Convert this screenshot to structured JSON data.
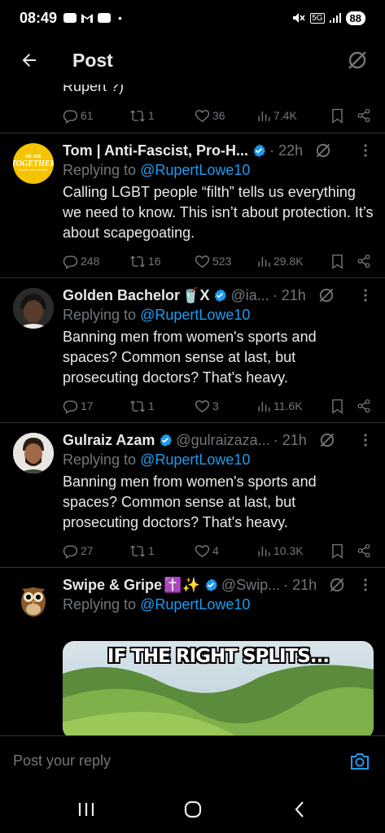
{
  "status": {
    "time": "08:49",
    "network": "5G",
    "battery": "88",
    "dot": "•"
  },
  "header": {
    "title": "Post"
  },
  "previous": {
    "text_tail": "Rupert ?)",
    "replies": "61",
    "reposts": "1",
    "likes": "36",
    "views": "7.4K"
  },
  "tweets": [
    {
      "name": "Tom | Anti-Fascist, Pro-H...",
      "handle": "",
      "time": "· 22h",
      "replying_prefix": "Replying to ",
      "replying_to": "@RupertLowe10",
      "text": "Calling LGBT people “filth” tells us everything we need to know. This isn’t about protection. It’s about scapegoating.",
      "replies": "248",
      "reposts": "16",
      "likes": "523",
      "views": "29.8K",
      "avatar_text_top": "WE ARE",
      "avatar_text_main": "TOGETHER",
      "avatar_text_bottom": "AGAINST THE FAR RIGHT"
    },
    {
      "name": "Golden Bachelor",
      "name_suffix": "🥤X",
      "handle": "@ia...",
      "time": "· 21h",
      "replying_prefix": "Replying to ",
      "replying_to": "@RupertLowe10",
      "text": "Banning men from women's sports and spaces? Common sense at last, but prosecuting doctors? That's heavy.",
      "replies": "17",
      "reposts": "1",
      "likes": "3",
      "views": "11.6K"
    },
    {
      "name": "Gulraiz Azam",
      "handle": "@gulraizaza...",
      "time": "· 21h",
      "replying_prefix": "Replying to ",
      "replying_to": "@RupertLowe10",
      "text": "Banning men from women's sports and spaces? Common sense at last, but prosecuting doctors? That's heavy.",
      "replies": "27",
      "reposts": "1",
      "likes": "4",
      "views": "10.3K"
    },
    {
      "name": "Swipe & Gripe",
      "name_suffix": "✝️✨",
      "handle": "@Swip...",
      "time": "· 21h",
      "replying_prefix": "Replying to ",
      "replying_to": "@RupertLowe10",
      "media_caption": "IF THE RIGHT SPLITS..."
    }
  ],
  "reply_bar": {
    "placeholder": "Post your reply"
  },
  "icons": {
    "back": "arrow-left-icon",
    "grok": "grok-icon",
    "more": "more-vertical-icon",
    "reply": "reply-icon",
    "repost": "repost-icon",
    "like": "heart-icon",
    "views": "views-icon",
    "bookmark": "bookmark-icon",
    "share": "share-icon",
    "camera": "camera-icon",
    "verified": "verified-badge-icon"
  },
  "colors": {
    "accent": "#1d9bf0",
    "secondary_text": "#71767b",
    "divider": "#2f3336"
  }
}
